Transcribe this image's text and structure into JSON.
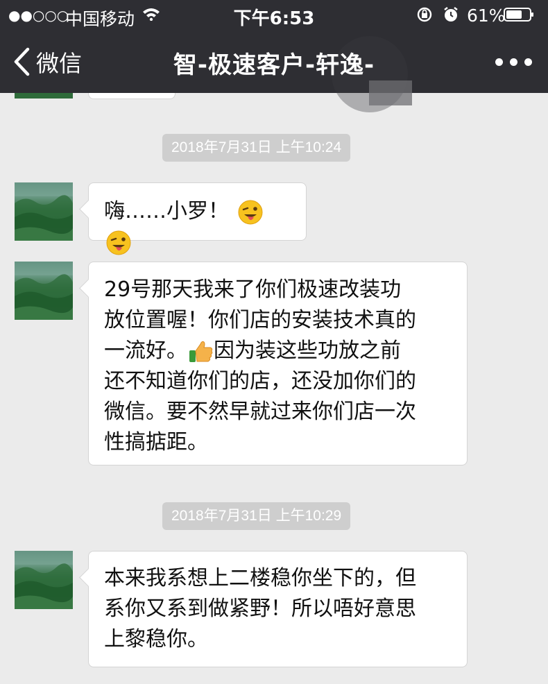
{
  "status_bar": {
    "signal": "●●○○○",
    "carrier": "中国移动",
    "time": "下午6:53",
    "battery_pct": "61%",
    "icons": [
      "wifi-icon",
      "orientation-lock-icon",
      "alarm-icon",
      "battery-icon"
    ]
  },
  "nav": {
    "back_label": "微信",
    "title": "智-极速客户-轩逸-",
    "more_icon": "more-dots-icon"
  },
  "messages": [
    {
      "type": "timestamp",
      "text": "2018年7月31日 上午10:24"
    },
    {
      "type": "incoming",
      "lines": [
        "嗨……小罗！"
      ],
      "emoji": [
        "winking-tongue-face",
        "winking-tongue-face"
      ]
    },
    {
      "type": "incoming",
      "lines": [
        "29号那天我来了你们极速改装功",
        "放位置喔！你们店的安装技术真的",
        "一流好。",
        "因为装这些功放之前",
        "还不知道你们的店，还没加你们的",
        "微信。要不然早就过来你们店一次",
        "性搞掂距。"
      ],
      "emoji": [
        "thumbs-up"
      ]
    },
    {
      "type": "timestamp",
      "text": "2018年7月31日 上午10:29"
    },
    {
      "type": "incoming",
      "lines": [
        "本来我系想上二楼稳你坐下的，但",
        "系你又系到做紧野！所以唔好意思",
        "上黎稳你。"
      ]
    }
  ],
  "colors": {
    "nav_bg": "#2e2e33",
    "chat_bg": "#ebebeb",
    "bubble_bg": "#ffffff",
    "timestamp_bg": "#cecece"
  }
}
